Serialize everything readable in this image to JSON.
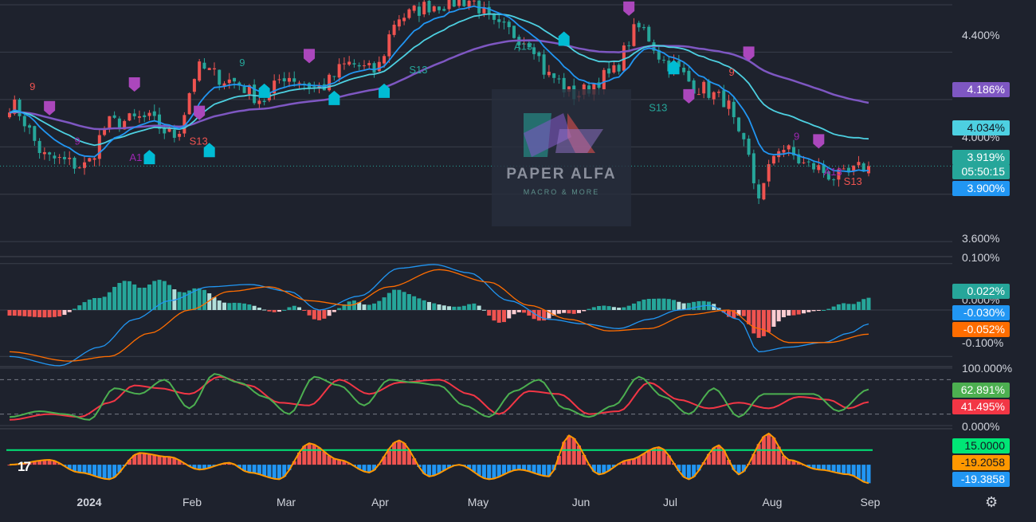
{
  "chart_data": [
    {
      "type": "candlestick",
      "title": "",
      "x_axis_labels": [
        "2024",
        "Feb",
        "Mar",
        "Apr",
        "May",
        "Jun",
        "Jul",
        "Aug",
        "Sep"
      ],
      "y_ticks": [
        "4.400%",
        "4.000%",
        "3.600%"
      ],
      "ylim": [
        3.55,
        4.62
      ],
      "price_tags": [
        {
          "value": "4.186%",
          "color": "#7e57c2"
        },
        {
          "value": "4.034%",
          "color": "#4dd0e1"
        },
        {
          "value": "3.919%",
          "color": "#26a69a"
        },
        {
          "value": "05:50:15",
          "color": "#26a69a"
        },
        {
          "value": "3.900%",
          "color": "#2196f3"
        }
      ],
      "moving_averages": [
        {
          "color": "#7e57c2",
          "last": 4.186
        },
        {
          "color": "#4dd0e1",
          "last": 4.034
        },
        {
          "color": "#2196f3",
          "last": 3.9
        }
      ],
      "close_anchors": [
        [
          0,
          4.18
        ],
        [
          8,
          3.95
        ],
        [
          15,
          3.92
        ],
        [
          20,
          4.1
        ],
        [
          27,
          4.12
        ],
        [
          33,
          4.05
        ],
        [
          38,
          4.33
        ],
        [
          44,
          4.28
        ],
        [
          51,
          4.2
        ],
        [
          55,
          4.3
        ],
        [
          62,
          4.25
        ],
        [
          68,
          4.35
        ],
        [
          73,
          4.32
        ],
        [
          78,
          4.55
        ],
        [
          85,
          4.6
        ],
        [
          92,
          4.62
        ],
        [
          98,
          4.5
        ],
        [
          104,
          4.45
        ],
        [
          108,
          4.3
        ],
        [
          113,
          4.22
        ],
        [
          120,
          4.3
        ],
        [
          126,
          4.5
        ],
        [
          132,
          4.35
        ],
        [
          138,
          4.25
        ],
        [
          143,
          4.2
        ],
        [
          147,
          4.0
        ],
        [
          150,
          3.8
        ],
        [
          154,
          4.0
        ],
        [
          160,
          3.92
        ],
        [
          166,
          3.87
        ],
        [
          172,
          3.92
        ]
      ],
      "annotations": [
        {
          "text": "9",
          "x": 4,
          "y": 4.24,
          "color": "#ef5350"
        },
        {
          "text": "9",
          "x": 13,
          "y": 4.01,
          "color": "#9c27b0"
        },
        {
          "text": "A1",
          "x": 24,
          "y": 3.94,
          "color": "#9c27b0"
        },
        {
          "text": "S13",
          "x": 36,
          "y": 4.01,
          "color": "#ef5350"
        },
        {
          "text": "9",
          "x": 46,
          "y": 4.34,
          "color": "#26a69a"
        },
        {
          "text": "A13",
          "x": 101,
          "y": 4.41,
          "color": "#26a69a"
        },
        {
          "text": "S13",
          "x": 80,
          "y": 4.31,
          "color": "#26a69a"
        },
        {
          "text": "S13",
          "x": 128,
          "y": 4.15,
          "color": "#26a69a"
        },
        {
          "text": "9",
          "x": 144,
          "y": 4.3,
          "color": "#ef5350"
        },
        {
          "text": "9",
          "x": 157,
          "y": 4.03,
          "color": "#9c27b0"
        },
        {
          "text": "A13",
          "x": 163,
          "y": 3.88,
          "color": "#9c27b0"
        },
        {
          "text": "S13",
          "x": 167,
          "y": 3.84,
          "color": "#ef5350"
        }
      ]
    },
    {
      "type": "macd",
      "y_ticks": [
        "0.100%",
        "0.000%",
        "-0.100%"
      ],
      "ylim": [
        -0.115,
        0.115
      ],
      "values": [
        {
          "label": "0.022%",
          "color": "#26a69a"
        },
        {
          "label": "-0.030%",
          "color": "#2196f3"
        },
        {
          "label": "-0.052%",
          "color": "#ff6d00"
        }
      ],
      "macd_anchors": [
        [
          0,
          -0.1
        ],
        [
          10,
          -0.12
        ],
        [
          18,
          -0.08
        ],
        [
          25,
          -0.02
        ],
        [
          32,
          0.02
        ],
        [
          40,
          0.05
        ],
        [
          48,
          0.055
        ],
        [
          56,
          0.04
        ],
        [
          62,
          0.0
        ],
        [
          70,
          0.03
        ],
        [
          78,
          0.09
        ],
        [
          85,
          0.098
        ],
        [
          92,
          0.08
        ],
        [
          100,
          0.02
        ],
        [
          108,
          -0.02
        ],
        [
          115,
          -0.03
        ],
        [
          122,
          -0.04
        ],
        [
          128,
          -0.02
        ],
        [
          134,
          0.0
        ],
        [
          140,
          0.01
        ],
        [
          146,
          -0.02
        ],
        [
          150,
          -0.09
        ],
        [
          156,
          -0.08
        ],
        [
          163,
          -0.07
        ],
        [
          168,
          -0.05
        ],
        [
          172,
          -0.03
        ]
      ],
      "signal_anchors": [
        [
          0,
          -0.09
        ],
        [
          12,
          -0.11
        ],
        [
          20,
          -0.1
        ],
        [
          28,
          -0.05
        ],
        [
          36,
          0.0
        ],
        [
          44,
          0.04
        ],
        [
          52,
          0.05
        ],
        [
          60,
          0.02
        ],
        [
          68,
          0.01
        ],
        [
          76,
          0.05
        ],
        [
          86,
          0.087
        ],
        [
          96,
          0.06
        ],
        [
          104,
          0.01
        ],
        [
          112,
          -0.02
        ],
        [
          120,
          -0.045
        ],
        [
          128,
          -0.04
        ],
        [
          136,
          -0.01
        ],
        [
          144,
          -0.0
        ],
        [
          150,
          -0.04
        ],
        [
          156,
          -0.07
        ],
        [
          164,
          -0.07
        ],
        [
          172,
          -0.052
        ]
      ]
    },
    {
      "type": "stochastic",
      "y_ticks": [
        "100.000%",
        "0.000%"
      ],
      "ylim": [
        0,
        100
      ],
      "guides": [
        80,
        20
      ],
      "values": [
        {
          "label": "62.891%",
          "color": "#4caf50"
        },
        {
          "label": "41.495%",
          "color": "#f23645"
        }
      ],
      "k_anchors": [
        [
          0,
          15
        ],
        [
          6,
          25
        ],
        [
          11,
          20
        ],
        [
          16,
          10
        ],
        [
          21,
          65
        ],
        [
          26,
          55
        ],
        [
          31,
          80
        ],
        [
          36,
          30
        ],
        [
          41,
          90
        ],
        [
          46,
          75
        ],
        [
          51,
          50
        ],
        [
          56,
          20
        ],
        [
          61,
          85
        ],
        [
          66,
          70
        ],
        [
          71,
          35
        ],
        [
          76,
          80
        ],
        [
          81,
          75
        ],
        [
          86,
          70
        ],
        [
          91,
          35
        ],
        [
          96,
          15
        ],
        [
          101,
          60
        ],
        [
          106,
          80
        ],
        [
          111,
          30
        ],
        [
          116,
          15
        ],
        [
          121,
          35
        ],
        [
          126,
          85
        ],
        [
          131,
          50
        ],
        [
          136,
          20
        ],
        [
          141,
          65
        ],
        [
          146,
          15
        ],
        [
          151,
          55
        ],
        [
          156,
          55
        ],
        [
          161,
          55
        ],
        [
          166,
          25
        ],
        [
          172,
          63
        ]
      ],
      "d_anchors": [
        [
          0,
          10
        ],
        [
          8,
          20
        ],
        [
          14,
          15
        ],
        [
          20,
          40
        ],
        [
          25,
          70
        ],
        [
          30,
          65
        ],
        [
          36,
          55
        ],
        [
          42,
          85
        ],
        [
          48,
          70
        ],
        [
          54,
          40
        ],
        [
          60,
          35
        ],
        [
          66,
          80
        ],
        [
          72,
          55
        ],
        [
          78,
          75
        ],
        [
          86,
          80
        ],
        [
          92,
          55
        ],
        [
          98,
          20
        ],
        [
          104,
          60
        ],
        [
          110,
          55
        ],
        [
          116,
          20
        ],
        [
          122,
          25
        ],
        [
          128,
          75
        ],
        [
          134,
          45
        ],
        [
          140,
          30
        ],
        [
          146,
          40
        ],
        [
          152,
          30
        ],
        [
          158,
          50
        ],
        [
          164,
          45
        ],
        [
          168,
          30
        ],
        [
          172,
          41
        ]
      ]
    },
    {
      "type": "oscillator",
      "ylim": [
        -22,
        32
      ],
      "values": [
        {
          "label": "15.0000",
          "color": "#00e676"
        },
        {
          "label": "-19.2058",
          "color": "#ff9800"
        },
        {
          "label": "-19.3858",
          "color": "#2196f3"
        }
      ],
      "threshold": 15,
      "line_anchors": [
        [
          0,
          0
        ],
        [
          8,
          5
        ],
        [
          14,
          -8
        ],
        [
          20,
          -15
        ],
        [
          26,
          12
        ],
        [
          32,
          8
        ],
        [
          38,
          -5
        ],
        [
          44,
          2
        ],
        [
          48,
          -8
        ],
        [
          54,
          -15
        ],
        [
          60,
          22
        ],
        [
          66,
          5
        ],
        [
          72,
          -8
        ],
        [
          78,
          25
        ],
        [
          84,
          -12
        ],
        [
          90,
          0
        ],
        [
          96,
          -15
        ],
        [
          102,
          -5
        ],
        [
          108,
          -12
        ],
        [
          112,
          30
        ],
        [
          118,
          -10
        ],
        [
          124,
          5
        ],
        [
          130,
          18
        ],
        [
          136,
          -15
        ],
        [
          142,
          20
        ],
        [
          146,
          -10
        ],
        [
          152,
          32
        ],
        [
          156,
          5
        ],
        [
          162,
          -5
        ],
        [
          168,
          -10
        ],
        [
          172,
          -19
        ]
      ]
    }
  ],
  "watermark": {
    "brand": "PAPER ALFA",
    "tagline": "MACRO & MORE"
  },
  "toolbar": {
    "logo": "17",
    "settings_icon": "gear-icon"
  }
}
